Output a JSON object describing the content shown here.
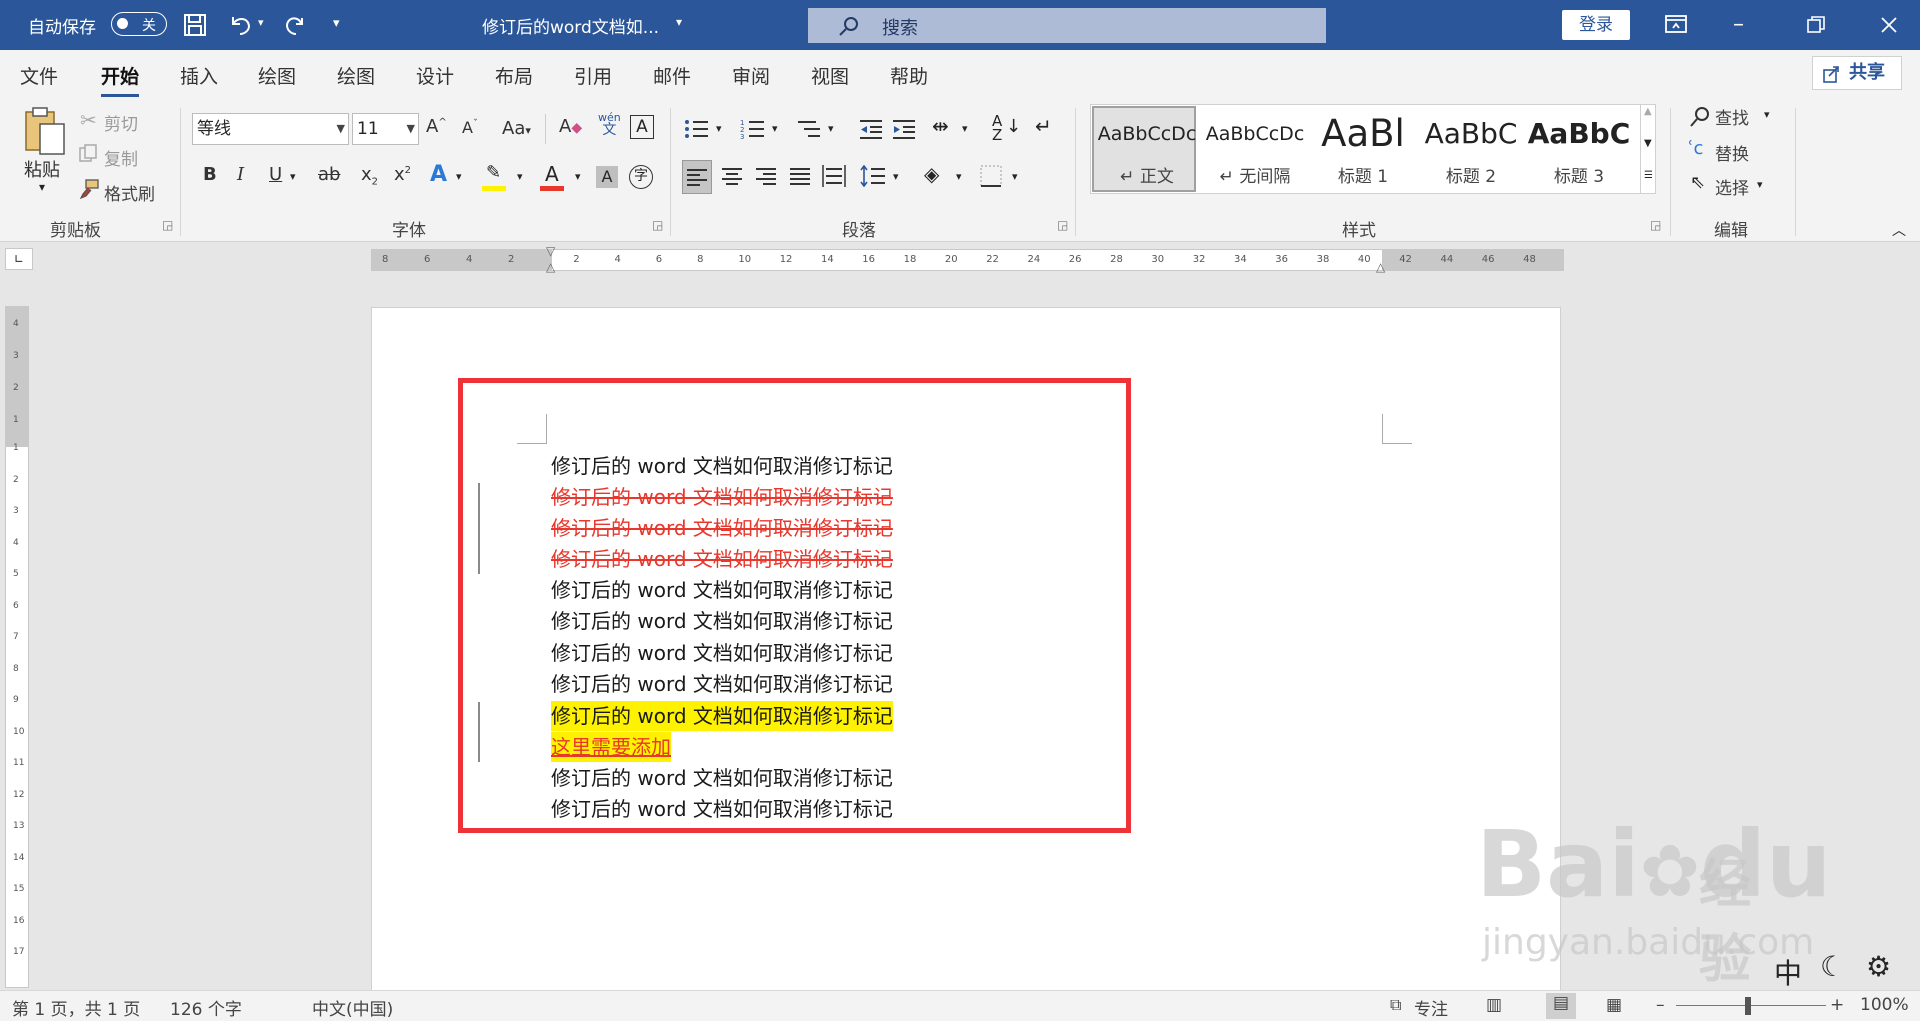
{
  "titlebar": {
    "autosave_label": "自动保存",
    "autosave_state": "关",
    "doc_title": "修订后的word文档如...",
    "search_placeholder": "搜索",
    "login": "登录",
    "accent_color": "#2b579a"
  },
  "tabs": [
    "文件",
    "开始",
    "插入",
    "绘图",
    "绘图",
    "设计",
    "布局",
    "引用",
    "邮件",
    "审阅",
    "视图",
    "帮助"
  ],
  "active_tab": "开始",
  "share": "共享",
  "clipboard": {
    "paste": "粘贴",
    "cut": "剪切",
    "copy": "复制",
    "format_painter": "格式刷",
    "group": "剪贴板"
  },
  "font": {
    "name": "等线",
    "size": "11",
    "group": "字体",
    "aa": "Aa",
    "wen_top": "wén",
    "wen_bottom": "文",
    "a_box": "A",
    "zi": "字"
  },
  "paragraph": {
    "group": "段落"
  },
  "styles": {
    "group": "样式",
    "items": [
      {
        "preview": "AaBbCcDc",
        "name": "↵ 正文"
      },
      {
        "preview": "AaBbCcDc",
        "name": "↵ 无间隔"
      },
      {
        "preview": "AaBl",
        "name": "标题 1"
      },
      {
        "preview": "AaBbC",
        "name": "标题 2"
      },
      {
        "preview": "AaBbC",
        "name": "标题 3"
      }
    ]
  },
  "editing": {
    "find": "查找",
    "replace": "替换",
    "select": "选择",
    "group": "编辑"
  },
  "ruler": {
    "marks": [
      "8",
      "6",
      "4",
      "2",
      "2",
      "4",
      "6",
      "8",
      "10",
      "12",
      "14",
      "16",
      "18",
      "20",
      "22",
      "24",
      "26",
      "28",
      "30",
      "32",
      "34",
      "36",
      "38",
      "40",
      "42",
      "44",
      "46",
      "48"
    ],
    "vmarks": [
      "4",
      "3",
      "2",
      "1",
      "1",
      "2",
      "3",
      "4",
      "5",
      "6",
      "7",
      "8",
      "9",
      "10",
      "11",
      "12",
      "13",
      "14",
      "15",
      "16",
      "17"
    ]
  },
  "document": {
    "lines": [
      {
        "text": "修订后的 word 文档如何取消修订标记",
        "style": "normal"
      },
      {
        "text": "修订后的 word 文档如何取消修订标记",
        "style": "deleted"
      },
      {
        "text": "修订后的 word 文档如何取消修订标记",
        "style": "deleted"
      },
      {
        "text": "修订后的 word 文档如何取消修订标记",
        "style": "deleted"
      },
      {
        "text": "修订后的 word 文档如何取消修订标记",
        "style": "normal"
      },
      {
        "text": "修订后的 word 文档如何取消修订标记",
        "style": "normal"
      },
      {
        "text": "修订后的 word 文档如何取消修订标记",
        "style": "normal"
      },
      {
        "text": "修订后的 word 文档如何取消修订标记",
        "style": "normal"
      },
      {
        "text": "修订后的 word 文档如何取消修订标记",
        "style": "highlight"
      },
      {
        "text": "这里需要添加",
        "style": "inserted"
      },
      {
        "text": "修订后的 word 文档如何取消修订标记",
        "style": "normal"
      },
      {
        "text": "修订后的 word 文档如何取消修订标记",
        "style": "normal"
      }
    ],
    "highlight_color": "#fff200",
    "revision_color": "#e8372c"
  },
  "statusbar": {
    "page": "第 1 页，共 1 页",
    "words": "126 个字",
    "language": "中文(中国)",
    "focus": "专注",
    "zoom": "100%",
    "ime": "中"
  },
  "watermark": {
    "brand": "Bai",
    "brand2": "du",
    "jingyan": "经验",
    "url": "jingyan.baidu.com"
  }
}
